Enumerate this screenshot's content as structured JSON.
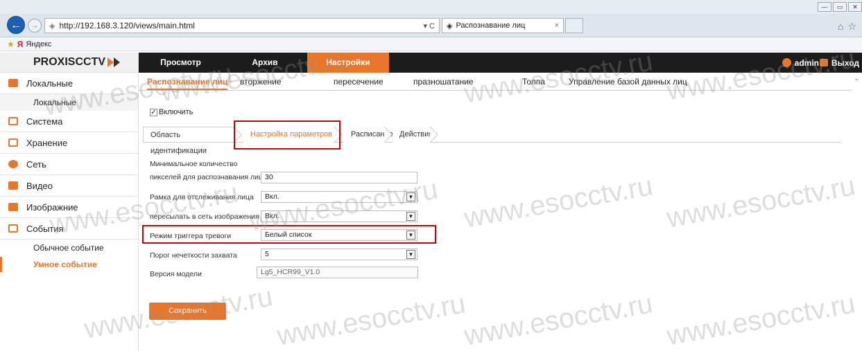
{
  "browser": {
    "url": "http://192.168.3.120/views/main.html",
    "tab_title": "Распознавание лиц",
    "tab_close": "×",
    "refresh": "▾ C",
    "favorites_item": "Яндекс",
    "favorites_icon": "Я"
  },
  "brand": "PROXISCCTV",
  "top_nav": {
    "items": [
      "Просмотр",
      "Архив",
      "Настройки"
    ],
    "user": "admin",
    "logout": "Выход"
  },
  "sidebar": {
    "items": [
      {
        "label": "Локальные",
        "icon": "monitor-icon",
        "color": "#e8762a"
      },
      {
        "sub": "Локальные"
      },
      {
        "label": "Система",
        "icon": "calendar-icon",
        "color": "#e8762a"
      },
      {
        "label": "Хранение",
        "icon": "storage-icon",
        "color": "#e8762a"
      },
      {
        "label": "Сеть",
        "icon": "network-icon",
        "color": "#e8762a"
      },
      {
        "label": "Видео",
        "icon": "video-icon",
        "color": "#e8762a"
      },
      {
        "label": "Изображние",
        "icon": "image-icon",
        "color": "#e8762a"
      },
      {
        "label": "События",
        "icon": "events-icon",
        "color": "#e8762a"
      }
    ],
    "event_sub": [
      "Обычное событие",
      "Умное событие"
    ]
  },
  "subtabs": [
    "Распознавание лиц",
    "вторжение",
    "пересечение",
    "празношатание",
    "Толпа",
    "Управление базой данных лиц"
  ],
  "enable_label": "Включить",
  "enable_checked": "✓",
  "steps": [
    "Область идентификации",
    "Настройка параметров",
    "Расписание",
    "Действия"
  ],
  "form": {
    "min_pixels_label_1": "Минимальное количество",
    "min_pixels_label_2": "пикселей для распознавания лица",
    "min_pixels_value": "30",
    "tracking_frame_label": "Рамка для отслеживания лица",
    "tracking_frame_value": "Вкл.",
    "send_images_label": "пересылать в сеть изображения",
    "send_images_value": "Вкл.",
    "trigger_mode_label": "Режим триггера тревоги",
    "trigger_mode_value": "Белый список",
    "fuzzy_label": "Порог нечеткости захвата",
    "fuzzy_value": "5",
    "model_label": "Версия модели",
    "model_value": "Lg5_HCR99_V1.0"
  },
  "save_label": "Сохранить",
  "watermark_text": "www.esocctv.ru",
  "colors": {
    "accent": "#e8762a",
    "highlight": "#cc0000",
    "topbar": "#1c1c1c"
  }
}
